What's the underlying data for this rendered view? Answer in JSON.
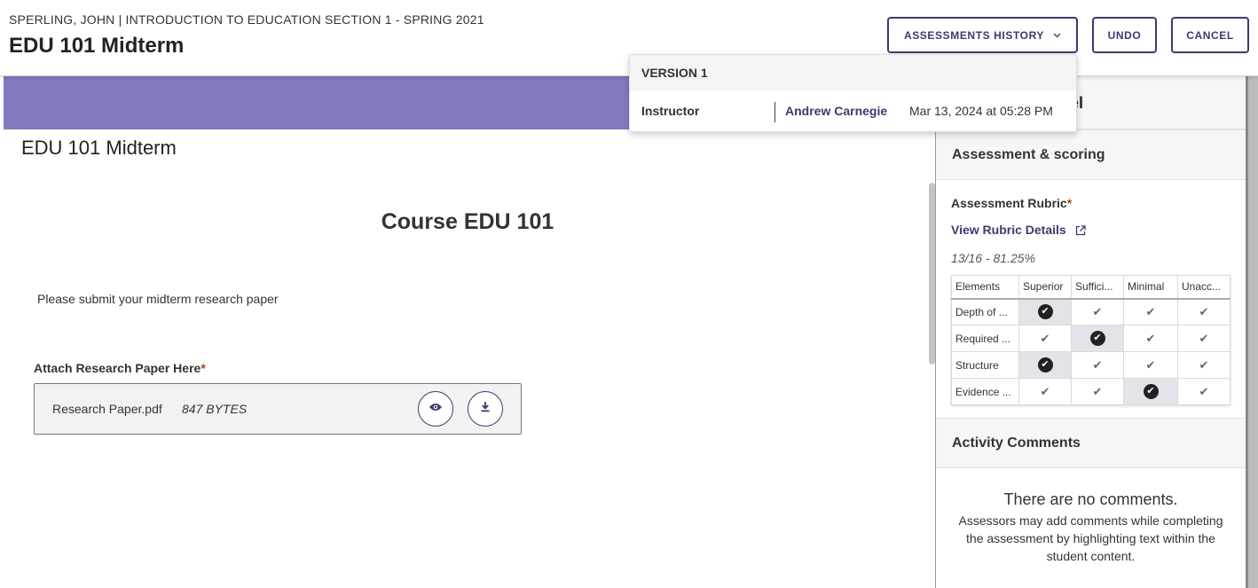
{
  "header": {
    "breadcrumb": "SPERLING, JOHN | INTRODUCTION TO EDUCATION SECTION 1 - SPRING 2021",
    "title": "EDU 101 Midterm",
    "history_button": "ASSESSMENTS HISTORY",
    "undo_button": "UNDO",
    "cancel_button": "CANCEL"
  },
  "history_dropdown": {
    "version_label": "VERSION 1",
    "entries": [
      {
        "role": "Instructor",
        "name": "Andrew Carnegie",
        "date": "Mar 13, 2024 at 05:28 PM"
      }
    ]
  },
  "content": {
    "title": "EDU 101 Midterm",
    "course_title": "Course EDU 101",
    "instructions": "Please submit your midterm research paper",
    "attach_label": "Attach Research Paper Here",
    "required_mark": "*",
    "file": {
      "name": "Research Paper.pdf",
      "size": "847 BYTES"
    }
  },
  "panel": {
    "header_partial": "nel",
    "assessment_section": "Assessment & scoring",
    "rubric_label": "Assessment Rubric",
    "rubric_link": "View Rubric Details",
    "score": "13/16 - 81.25%",
    "rubric": {
      "columns": [
        "Elements",
        "Superior",
        "Suffici...",
        "Minimal",
        "Unacc..."
      ],
      "rows": [
        {
          "element": "Depth of ...",
          "selected": 0
        },
        {
          "element": "Required ...",
          "selected": 1
        },
        {
          "element": "Structure",
          "selected": 0
        },
        {
          "element": "Evidence ...",
          "selected": 2
        }
      ]
    },
    "activity_section": "Activity Comments",
    "no_comments": "There are no comments.",
    "comments_help": "Assessors may add comments while completing the assessment by highlighting text within the student content."
  },
  "icons": {
    "chevron": "chevron-down-icon",
    "view": "eye-icon",
    "download": "download-icon",
    "external": "external-link-icon",
    "check": "check-icon",
    "selected": "check-circle-icon"
  },
  "colors": {
    "accent": "#3d3a6e",
    "banner": "#807bc0",
    "required": "#b43a1c"
  }
}
